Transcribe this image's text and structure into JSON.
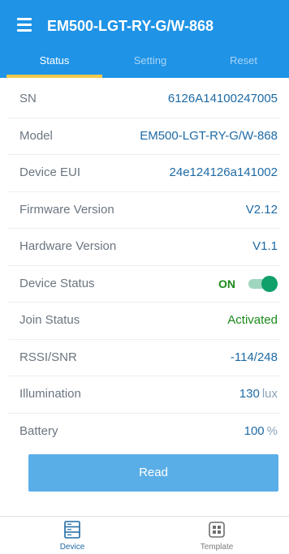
{
  "header": {
    "title": "EM500-LGT-RY-G/W-868",
    "menu_icon": "hamburger-menu-icon",
    "tabs": [
      {
        "label": "Status",
        "active": true
      },
      {
        "label": "Setting",
        "active": false
      },
      {
        "label": "Reset",
        "active": false
      }
    ]
  },
  "rows": [
    {
      "label": "SN",
      "value": "6126A14100247005"
    },
    {
      "label": "Model",
      "value": "EM500-LGT-RY-G/W-868"
    },
    {
      "label": "Device EUI",
      "value": "24e124126a141002"
    },
    {
      "label": "Firmware Version",
      "value": "V2.12"
    },
    {
      "label": "Hardware Version",
      "value": "V1.1"
    },
    {
      "label": "Device Status",
      "value": "ON",
      "toggle_on": true
    },
    {
      "label": "Join Status",
      "value": "Activated"
    },
    {
      "label": "RSSI/SNR",
      "value": "-114/248"
    },
    {
      "label": "Illumination",
      "value": "130",
      "unit": "lux"
    },
    {
      "label": "Battery",
      "value": "100",
      "unit": "%"
    }
  ],
  "read_button": {
    "label": "Read"
  },
  "bottom_nav": [
    {
      "label": "Device",
      "icon": "device-icon",
      "active": true
    },
    {
      "label": "Template",
      "icon": "template-icon",
      "active": false
    }
  ],
  "colors": {
    "header_bg": "#1f93e6",
    "tab_indicator": "#f2c94c",
    "value_blue": "#1e6aa5",
    "status_green": "#1a8a1a",
    "toggle_on": "#11a06a",
    "button_bg": "#5aaee8"
  }
}
